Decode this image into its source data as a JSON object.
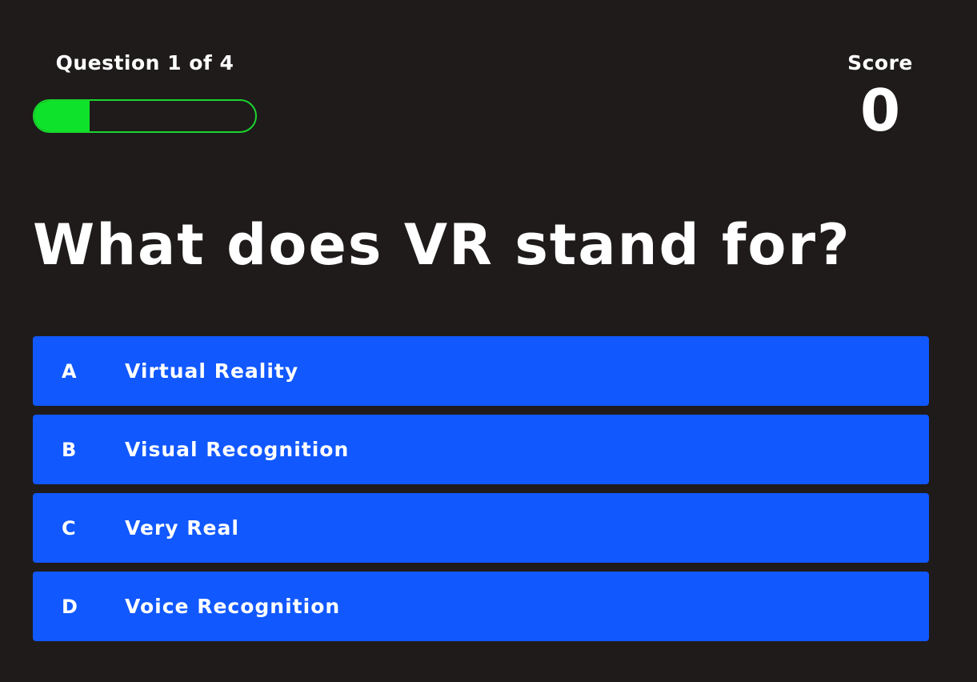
{
  "hud": {
    "progress_text": "Question 1 of 4",
    "progress_fraction": 0.25,
    "score_label": "Score",
    "score_value": "0"
  },
  "question": {
    "text": "What does VR stand for?"
  },
  "answers": [
    {
      "letter": "A",
      "text": "Virtual Reality"
    },
    {
      "letter": "B",
      "text": "Visual Recognition"
    },
    {
      "letter": "C",
      "text": "Very Real"
    },
    {
      "letter": "D",
      "text": "Voice Recognition"
    }
  ],
  "colors": {
    "background": "#1f1b1b",
    "progress_fill": "#0fe22a",
    "answer_bg": "#1158ff",
    "text": "#ffffff"
  }
}
